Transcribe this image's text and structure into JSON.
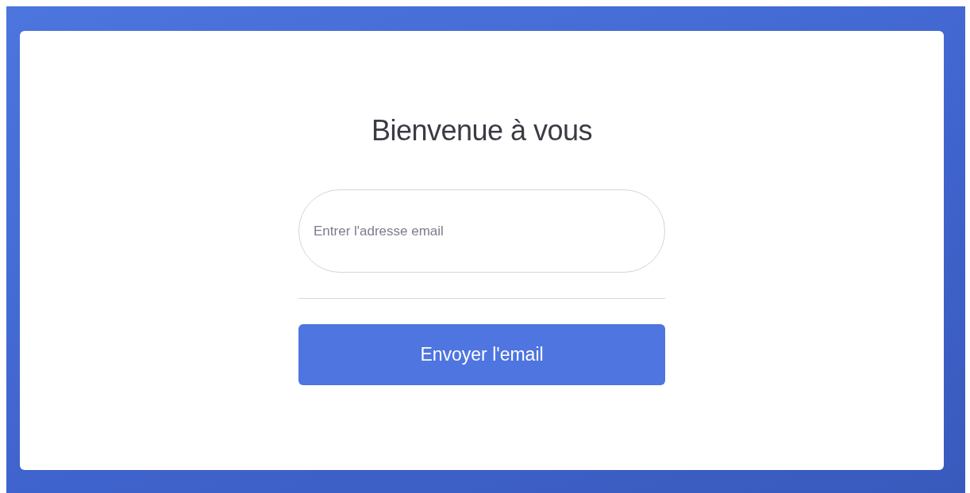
{
  "heading": "Bienvenue à vous",
  "email_field": {
    "placeholder": "Entrer l'adresse email"
  },
  "submit_button": {
    "label": "Envoyer l'email"
  }
}
